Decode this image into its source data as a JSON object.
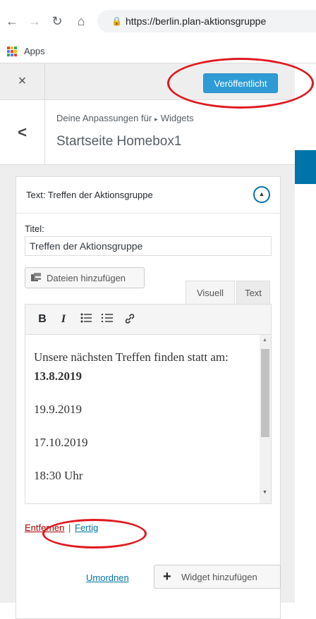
{
  "browser": {
    "url": "https://berlin.plan-aktionsgruppe",
    "bookmarks_apps_label": "Apps",
    "apps_colors": [
      "#ea4335",
      "#fbbc05",
      "#34a853",
      "#4285f4",
      "#ea4335",
      "#fbbc05",
      "#34a853",
      "#4285f4",
      "#ea4335"
    ]
  },
  "header": {
    "close_icon": "×",
    "publish_label": "Veröffentlicht"
  },
  "section": {
    "breadcrumb_prefix": "Deine Anpassungen für",
    "breadcrumb_arrow": "▸",
    "breadcrumb_target": "Widgets",
    "title": "Startseite Homebox1",
    "back_icon": "<"
  },
  "widget": {
    "title_prefix": "Text:",
    "title_name": "Treffen der Aktionsgruppe",
    "field_label": "Titel:",
    "field_value": "Treffen der Aktionsgruppe",
    "add_media_label": "Dateien hinzufügen",
    "tabs": {
      "visual": "Visuell",
      "text": "Text"
    },
    "toolbar": {
      "bold": "B",
      "italic": "I",
      "ul": "☰",
      "ol": "☷",
      "link": "🔗"
    },
    "content": {
      "intro": "Unsere nächsten Treffen finden statt am:",
      "date_bold": "13.8.2019",
      "date2": "19.9.2019",
      "date3": "17.10.2019",
      "time": "18:30 Uhr"
    },
    "remove_label": "Entfernen",
    "separator": "|",
    "done_label": "Fertig"
  },
  "footer": {
    "reorder_label": "Umordnen",
    "add_widget_label": "Widget hinzufügen",
    "plus_icon": "+"
  },
  "colors": {
    "publish": "#2e9bd6",
    "link": "#0073aa",
    "remove": "#aa0000",
    "annotation": "#e0191f"
  }
}
